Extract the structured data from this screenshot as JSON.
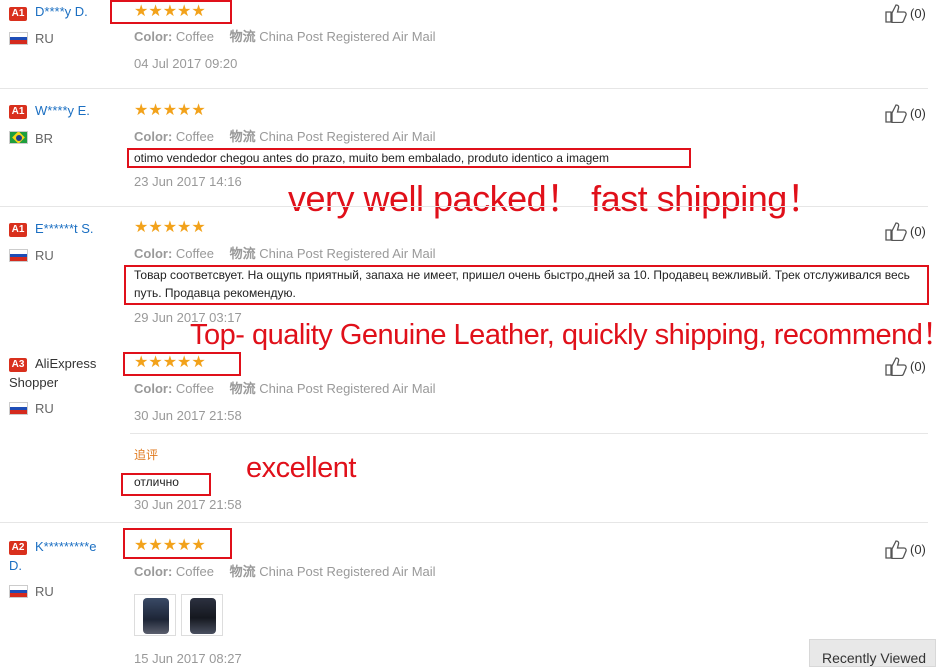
{
  "reviews": [
    {
      "badge": "A1",
      "name": "D****y D.",
      "name_line2": "",
      "country": "RU",
      "flag": "ru",
      "stars": "★★★★★",
      "color_label": "Color:",
      "color_value": "Coffee",
      "logistics_label": "物流",
      "logistics_value": "China Post Registered Air Mail",
      "feedback": "",
      "date": "04 Jul 2017 09:20",
      "helpful": "(0)"
    },
    {
      "badge": "A1",
      "name": "W****y E.",
      "name_line2": "",
      "country": "BR",
      "flag": "br",
      "stars": "★★★★★",
      "color_label": "Color:",
      "color_value": "Coffee",
      "logistics_label": "物流",
      "logistics_value": "China Post Registered Air Mail",
      "feedback": "otimo vendedor chegou antes do prazo, muito bem embalado, produto identico a imagem",
      "date": "23 Jun 2017 14:16",
      "helpful": "(0)"
    },
    {
      "badge": "A1",
      "name": "E******t S.",
      "name_line2": "",
      "country": "RU",
      "flag": "ru",
      "stars": "★★★★★",
      "color_label": "Color:",
      "color_value": "Coffee",
      "logistics_label": "物流",
      "logistics_value": "China Post Registered Air Mail",
      "feedback": "Товар соответсвует. На ощупь приятный, запаха не имеет, пришел очень быстро,дней за 10. Продавец вежливый. Трек отслуживался весь путь. Продавца рекомендую.",
      "date": "29 Jun 2017 03:17",
      "helpful": "(0)"
    },
    {
      "badge": "A3",
      "name": "AliExpress",
      "name_line2": "Shopper",
      "country": "RU",
      "flag": "ru",
      "stars": "★★★★★",
      "color_label": "Color:",
      "color_value": "Coffee",
      "logistics_label": "物流",
      "logistics_value": "China Post Registered Air Mail",
      "feedback": "",
      "date": "30 Jun 2017 21:58",
      "helpful": "(0)",
      "followup_label": "追评",
      "followup_text": "отлично",
      "followup_date": "30 Jun 2017 21:58"
    },
    {
      "badge": "A2",
      "name": "K*********e",
      "name_line2": "D.",
      "country": "RU",
      "flag": "ru",
      "stars": "★★★★★",
      "color_label": "Color:",
      "color_value": "Coffee",
      "logistics_label": "物流",
      "logistics_value": "China Post Registered Air Mail",
      "feedback": "",
      "date": "15 Jun 2017 08:27",
      "helpful": "(0)"
    }
  ],
  "annotations": {
    "packed": "very well packed！ fast shipping！",
    "leather": "Top- quality Genuine Leather, quickly shipping, recommend！",
    "excellent": "excellent"
  },
  "recently_viewed": "Recently Viewed",
  "colors": {
    "accent_red": "#e0101a",
    "star_orange": "#f2a21b",
    "link_blue": "#1b6fc2",
    "badge_red": "#d9301d"
  }
}
